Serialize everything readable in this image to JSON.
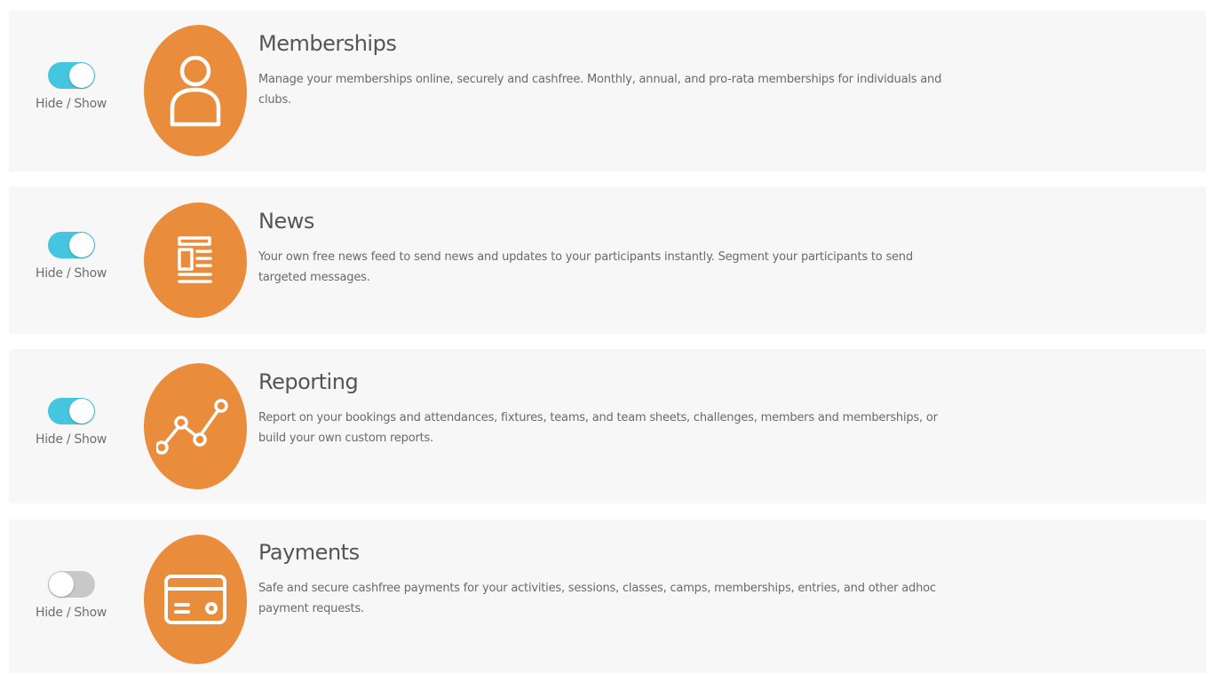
{
  "colors": {
    "accent": "#e98c3b",
    "toggle_on": "#45c5e0",
    "toggle_off": "#c8c8c8",
    "card_bg": "#f7f7f7"
  },
  "features": [
    {
      "id": "memberships",
      "title": "Memberships",
      "description": "Manage your memberships online, securely and cashfree. Monthly, annual, and pro-rata memberships for individuals and clubs.",
      "toggle_label": "Hide / Show",
      "enabled": true,
      "icon": "user-icon"
    },
    {
      "id": "news",
      "title": "News",
      "description": "Your own free news feed to send news and updates to your participants instantly. Segment your participants to send targeted messages.",
      "toggle_label": "Hide / Show",
      "enabled": true,
      "icon": "newspaper-icon"
    },
    {
      "id": "reporting",
      "title": "Reporting",
      "description": "Report on your bookings and attendances, fixtures, teams, and team sheets, challenges, members and memberships, or build your own custom reports.",
      "toggle_label": "Hide / Show",
      "enabled": true,
      "icon": "line-chart-icon"
    },
    {
      "id": "payments",
      "title": "Payments",
      "description": "Safe and secure cashfree payments for your activities, sessions, classes, camps, memberships, entries, and other adhoc payment requests.",
      "toggle_label": "Hide / Show",
      "enabled": false,
      "icon": "credit-card-icon"
    }
  ]
}
